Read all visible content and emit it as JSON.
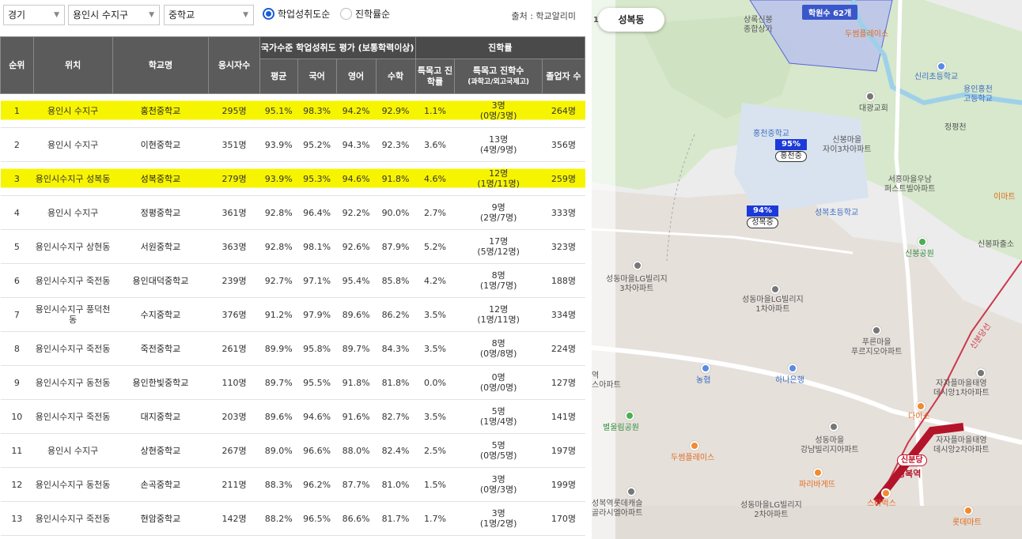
{
  "filters": {
    "region": "경기",
    "district": "용인시 수지구",
    "school_type": "중학교",
    "sort_options": [
      {
        "label": "학업성취도순",
        "selected": true
      },
      {
        "label": "진학률순",
        "selected": false
      }
    ],
    "source": "출처 : 학교알리미"
  },
  "table": {
    "headers": {
      "rank": "순위",
      "location": "위치",
      "school": "학교명",
      "exam_count": "응시자수",
      "group_achievement": "국가수준 학업성취도 평가 (보통학력이상)",
      "avg": "평균",
      "korean": "국어",
      "english": "영어",
      "math": "수학",
      "group_advance": "진학률",
      "special_rate": "특목고 진학률",
      "special_count": "특목고 진학수",
      "special_count_sub": "(과학고/외고국제고)",
      "graduates": "졸업자 수"
    },
    "rows": [
      {
        "rank": "1",
        "loc": "용인시 수지구",
        "school": "홍천중학교",
        "exam": "295명",
        "avg": "95.1%",
        "kor": "98.3%",
        "eng": "94.2%",
        "math": "92.9%",
        "rate": "1.1%",
        "cnt": "3명",
        "cnt_sub": "(0명/3명)",
        "grad": "264명",
        "highlight": true
      },
      {
        "rank": "2",
        "loc": "용인시 수지구",
        "school": "이현중학교",
        "exam": "351명",
        "avg": "93.9%",
        "kor": "95.2%",
        "eng": "94.3%",
        "math": "92.3%",
        "rate": "3.6%",
        "cnt": "13명",
        "cnt_sub": "(4명/9명)",
        "grad": "356명",
        "highlight": false
      },
      {
        "rank": "3",
        "loc": "용인시수지구 성복동",
        "school": "성복중학교",
        "exam": "279명",
        "avg": "93.9%",
        "kor": "95.3%",
        "eng": "94.6%",
        "math": "91.8%",
        "rate": "4.6%",
        "cnt": "12명",
        "cnt_sub": "(1명/11명)",
        "grad": "259명",
        "highlight": true
      },
      {
        "rank": "4",
        "loc": "용인시 수지구",
        "school": "정평중학교",
        "exam": "361명",
        "avg": "92.8%",
        "kor": "96.4%",
        "eng": "92.2%",
        "math": "90.0%",
        "rate": "2.7%",
        "cnt": "9명",
        "cnt_sub": "(2명/7명)",
        "grad": "333명",
        "highlight": false
      },
      {
        "rank": "5",
        "loc": "용인시수지구 상현동",
        "school": "서원중학교",
        "exam": "363명",
        "avg": "92.8%",
        "kor": "98.1%",
        "eng": "92.6%",
        "math": "87.9%",
        "rate": "5.2%",
        "cnt": "17명",
        "cnt_sub": "(5명/12명)",
        "grad": "323명",
        "highlight": false
      },
      {
        "rank": "6",
        "loc": "용인시수지구 죽전동",
        "school": "용인대덕중학교",
        "exam": "239명",
        "avg": "92.7%",
        "kor": "97.1%",
        "eng": "95.4%",
        "math": "85.8%",
        "rate": "4.2%",
        "cnt": "8명",
        "cnt_sub": "(1명/7명)",
        "grad": "188명",
        "highlight": false
      },
      {
        "rank": "7",
        "loc": "용인시수지구 풍덕천동",
        "school": "수지중학교",
        "exam": "376명",
        "avg": "91.2%",
        "kor": "97.9%",
        "eng": "89.6%",
        "math": "86.2%",
        "rate": "3.5%",
        "cnt": "12명",
        "cnt_sub": "(1명/11명)",
        "grad": "334명",
        "highlight": false
      },
      {
        "rank": "8",
        "loc": "용인시수지구 죽전동",
        "school": "죽전중학교",
        "exam": "261명",
        "avg": "89.9%",
        "kor": "95.8%",
        "eng": "89.7%",
        "math": "84.3%",
        "rate": "3.5%",
        "cnt": "8명",
        "cnt_sub": "(0명/8명)",
        "grad": "224명",
        "highlight": false
      },
      {
        "rank": "9",
        "loc": "용인시수지구 동천동",
        "school": "용인한빛중학교",
        "exam": "110명",
        "avg": "89.7%",
        "kor": "95.5%",
        "eng": "91.8%",
        "math": "81.8%",
        "rate": "0.0%",
        "cnt": "0명",
        "cnt_sub": "(0명/0명)",
        "grad": "127명",
        "highlight": false
      },
      {
        "rank": "10",
        "loc": "용인시수지구 죽전동",
        "school": "대지중학교",
        "exam": "203명",
        "avg": "89.6%",
        "kor": "94.6%",
        "eng": "91.6%",
        "math": "82.7%",
        "rate": "3.5%",
        "cnt": "5명",
        "cnt_sub": "(1명/4명)",
        "grad": "141명",
        "highlight": false
      },
      {
        "rank": "11",
        "loc": "용인시 수지구",
        "school": "상현중학교",
        "exam": "267명",
        "avg": "89.0%",
        "kor": "96.6%",
        "eng": "88.0%",
        "math": "82.4%",
        "rate": "2.5%",
        "cnt": "5명",
        "cnt_sub": "(0명/5명)",
        "grad": "197명",
        "highlight": false
      },
      {
        "rank": "12",
        "loc": "용인시수지구 동천동",
        "school": "손곡중학교",
        "exam": "211명",
        "avg": "88.3%",
        "kor": "96.2%",
        "eng": "87.7%",
        "math": "81.0%",
        "rate": "1.5%",
        "cnt": "3명",
        "cnt_sub": "(0명/3명)",
        "grad": "199명",
        "highlight": false
      },
      {
        "rank": "13",
        "loc": "용인시수지구 죽전동",
        "school": "현암중학교",
        "exam": "142명",
        "avg": "88.2%",
        "kor": "96.5%",
        "eng": "86.6%",
        "math": "81.7%",
        "rate": "1.7%",
        "cnt": "3명",
        "cnt_sub": "(1명/2명)",
        "grad": "170명",
        "highlight": false
      }
    ]
  },
  "map": {
    "location_chip": "성복동",
    "academy_badge": "학원수 62개",
    "schools": [
      {
        "pct": "95%",
        "name": "홍천중"
      },
      {
        "pct": "94%",
        "name": "성복중"
      }
    ],
    "labels": {
      "l1": "상록신봉\n종합상가",
      "l2": "두썸플레이스",
      "l3": "신리초등학교",
      "l4": "용인홍천\n고등학교",
      "l5": "대광교회",
      "l6": "정평천",
      "l7": "홍천중학교",
      "l8": "신봉마을\n자이3차아파트",
      "l9": "서홍마을우남\n퍼스트빌아파트",
      "l10": "이마트",
      "l11": "성복초등학교",
      "l12": "신봉공원",
      "l13": "신봉파출소",
      "l14": "성동마을LG빌리지\n3차아파트",
      "l15": "성동마을LG빌리지\n1차아파트",
      "l16": "푸른마을\n푸르지오아파트",
      "l17": "농협",
      "l18": "하나은행",
      "l19": "자자플마을태영\n데시앙1차아파트",
      "l20": "별울림공원",
      "l21": "다이소",
      "l22": "성동마을\n강남빌리지아파트",
      "l23": "자자플마을태영\n데시앙2차아파트",
      "l24": "두썸플레이스",
      "l25": "파리바게뜨",
      "l26": "성동마을LG빌리지\n2차아파트",
      "l27": "성복역롯데캐슬\n골라시엘아파트",
      "l28": "스타벅스",
      "l29": "롯데마트",
      "l30": "성복역",
      "l31": "역\n스아파트",
      "l32": "신분당선",
      "l33": "1"
    },
    "station_tag": "신분당"
  }
}
